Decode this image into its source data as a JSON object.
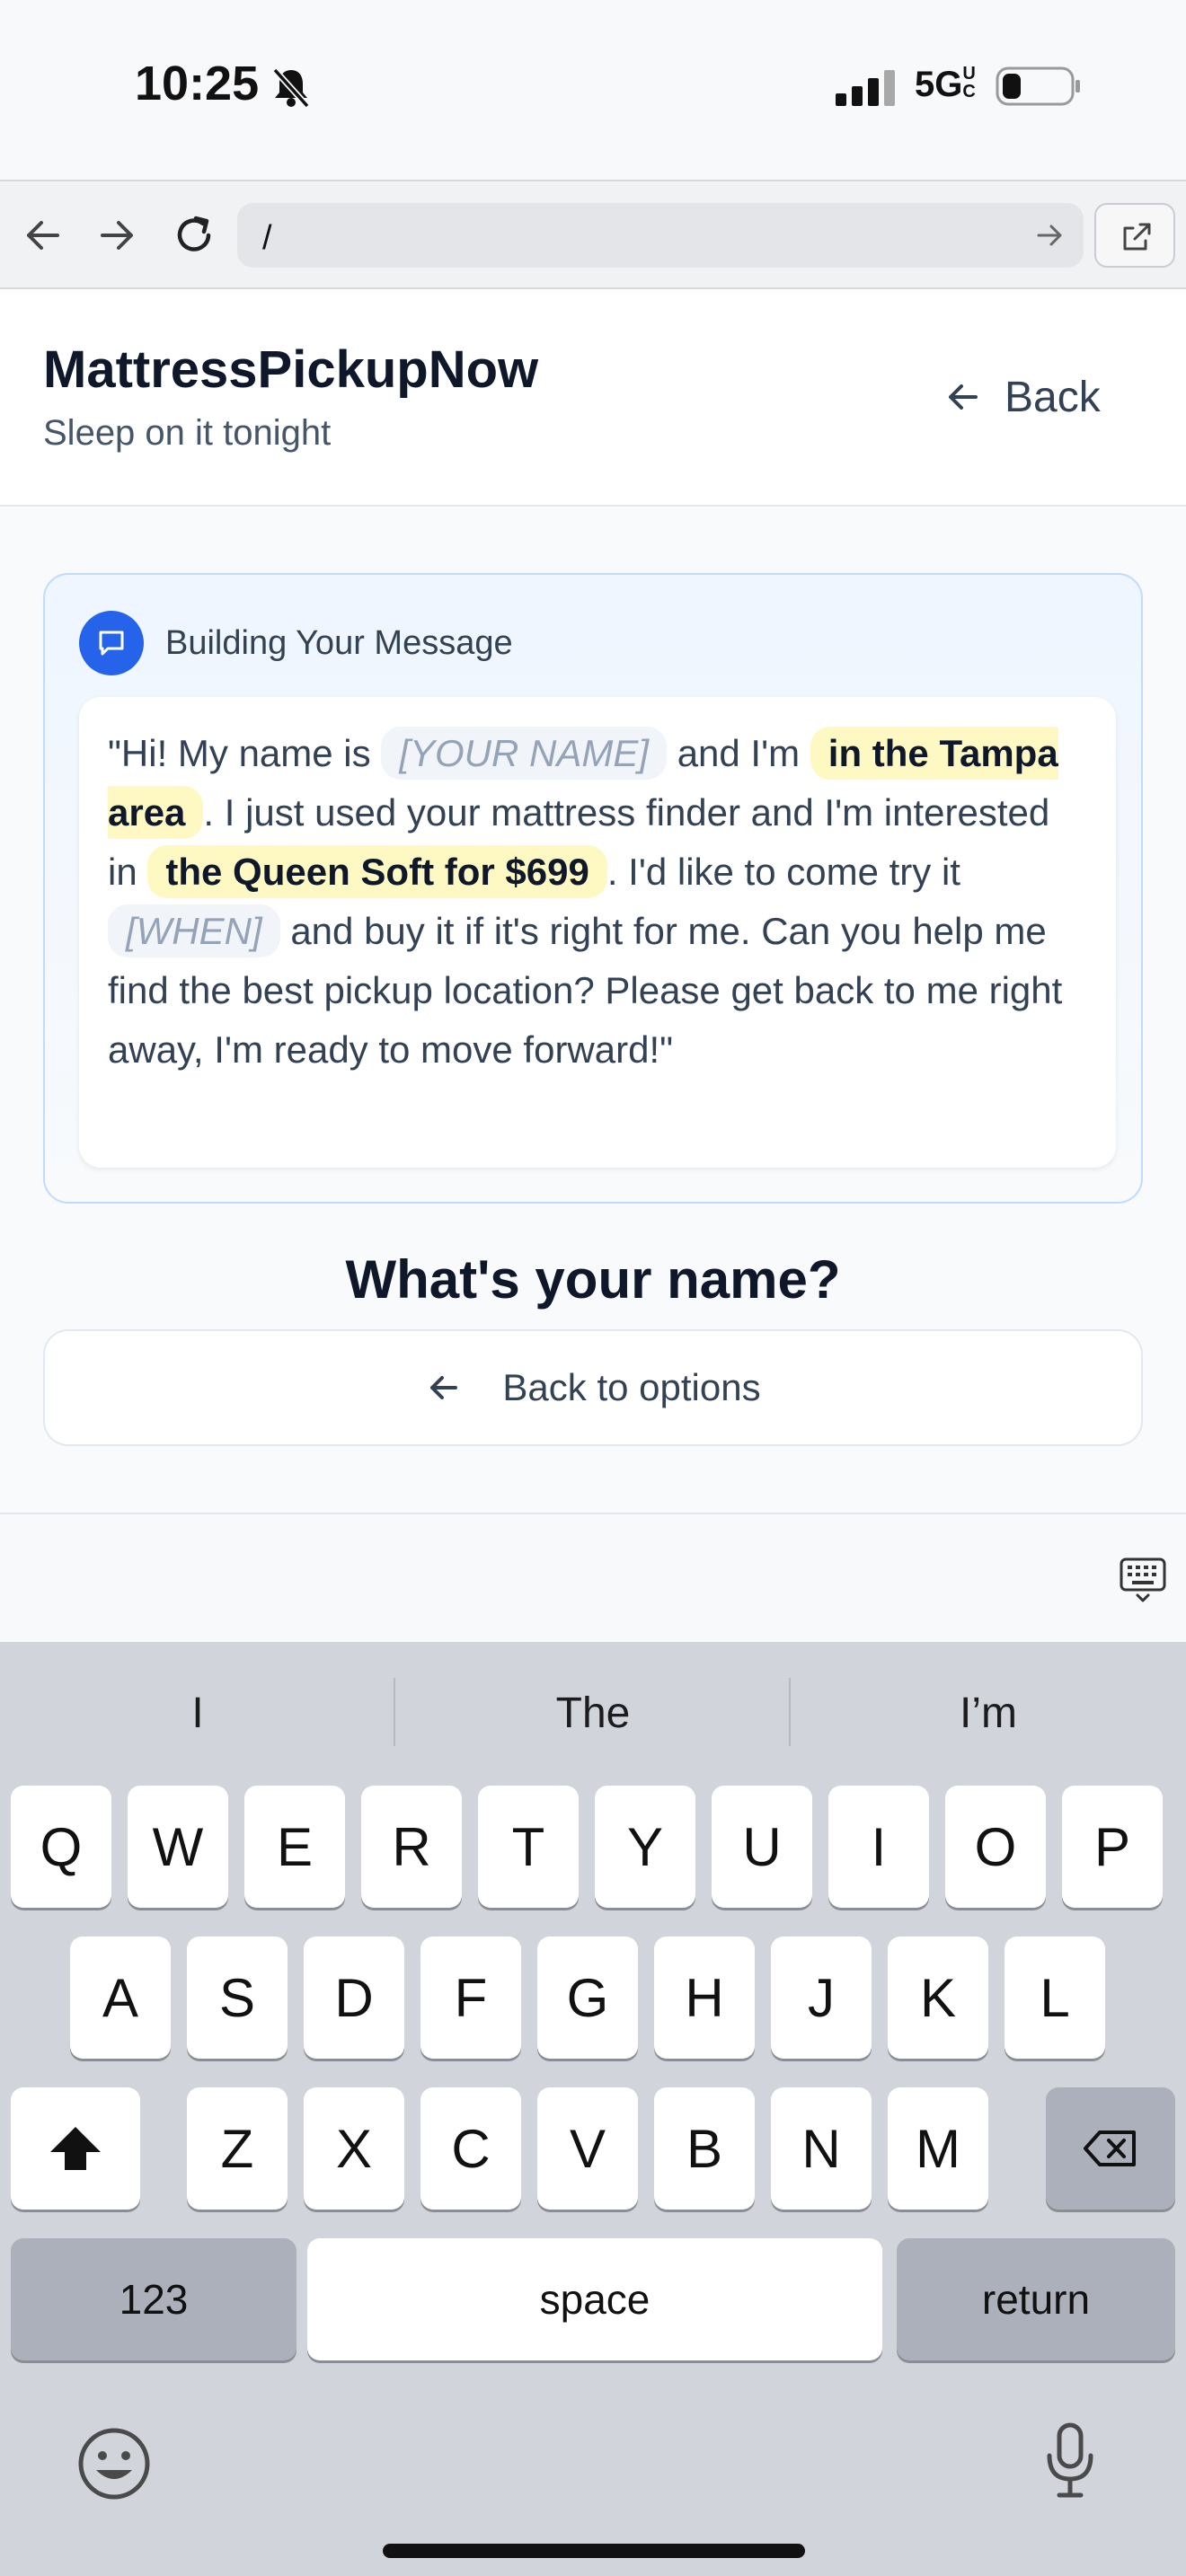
{
  "status_bar": {
    "time": "10:25",
    "network": "5G",
    "network_suffix": "UC"
  },
  "browser": {
    "url": "/"
  },
  "header": {
    "brand": "MattressPickupNow",
    "tagline": "Sleep on it tonight",
    "back_label": "Back"
  },
  "message_card": {
    "title": "Building Your Message",
    "parts": {
      "p1": "\"Hi! My name is",
      "name_placeholder": "[YOUR NAME]",
      "p2": "and I'm",
      "location": "in the Tampa area",
      "p3": ". I just used your mattress finder and I'm interested in",
      "product": "the Queen Soft for $699",
      "p4": ". I'd like to come try it",
      "when_placeholder": "[WHEN]",
      "p5": "and buy it if it's right for me. Can you help me find the best pickup location? Please get back to me right away, I'm ready to move forward!\""
    }
  },
  "question": "What's your name?",
  "back_to_options": "Back to options",
  "keyboard": {
    "suggestions": [
      "I",
      "The",
      "I’m"
    ],
    "row1": [
      "Q",
      "W",
      "E",
      "R",
      "T",
      "Y",
      "U",
      "I",
      "O",
      "P"
    ],
    "row2": [
      "A",
      "S",
      "D",
      "F",
      "G",
      "H",
      "J",
      "K",
      "L"
    ],
    "row3": [
      "Z",
      "X",
      "C",
      "V",
      "B",
      "N",
      "M"
    ],
    "numbers_label": "123",
    "space_label": "space",
    "return_label": "return"
  },
  "colors": {
    "accent": "#2563eb",
    "highlight": "#fef9c3",
    "placeholder_bg": "#f1f5f9",
    "card_border": "#bfdbfe"
  },
  "icons": [
    "bell-slash-icon",
    "signal-icon",
    "battery-icon",
    "back-arrow-icon",
    "forward-arrow-icon",
    "reload-icon",
    "go-arrow-icon",
    "external-link-icon",
    "arrow-left-icon",
    "chat-icon",
    "keyboard-dismiss-icon",
    "shift-icon",
    "delete-icon",
    "emoji-icon",
    "microphone-icon"
  ]
}
